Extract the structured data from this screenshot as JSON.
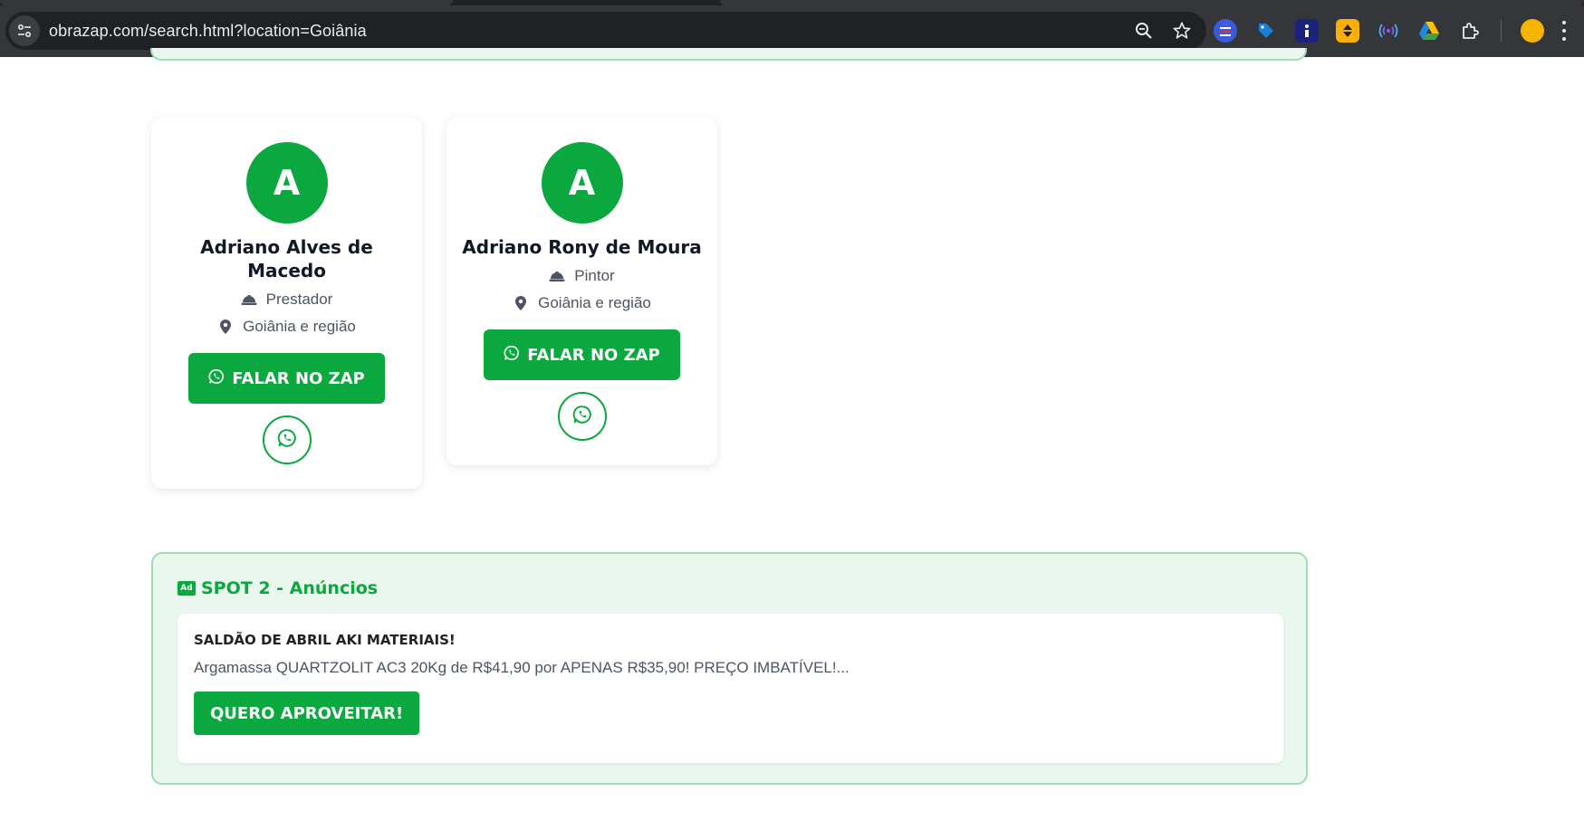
{
  "browser": {
    "url": "obrazap.com/search.html?location=Goiânia"
  },
  "providers": [
    {
      "initial": "A",
      "name": "Adriano Alves de Macedo",
      "role": "Prestador",
      "location": "Goiânia e região",
      "button_label": "FALAR NO ZAP"
    },
    {
      "initial": "A",
      "name": "Adriano Rony de Moura",
      "role": "Pintor",
      "location": "Goiânia e região",
      "button_label": "FALAR NO ZAP"
    }
  ],
  "ad_spot": {
    "badge": "Ad",
    "title": "SPOT 2 - Anúncios",
    "headline": "SALDÃO DE ABRIL AKI MATERIAIS!",
    "text": "Argamassa QUARTZOLIT AC3 20Kg de R$41,90 por APENAS R$35,90! PREÇO IMBATÍVEL!...",
    "cta_label": "QUERO APROVEITAR!"
  },
  "colors": {
    "brand_green": "#0aa83f",
    "ad_background": "#eaf7ee",
    "ad_border": "#9edcb1",
    "chrome_dark": "#35363a"
  },
  "icons": {
    "role": "hard-hat-icon",
    "location": "map-pin-icon",
    "whatsapp": "whatsapp-icon"
  }
}
